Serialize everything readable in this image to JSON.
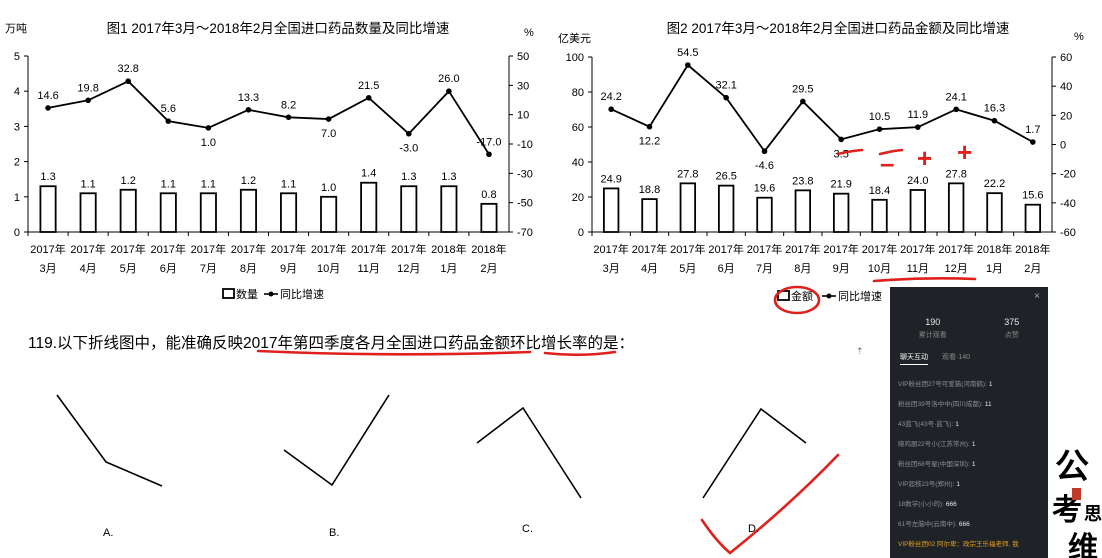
{
  "chart_data": [
    {
      "type": "bar+line",
      "title": "图1  2017年3月～2018年2月全国进口药品数量及同比增速",
      "ylabel_left": "万吨",
      "ylabel_right": "%",
      "yticks_left": [
        "0",
        "1",
        "2",
        "3",
        "4",
        "5"
      ],
      "yticks_right": [
        "-70",
        "-50",
        "-30",
        "-10",
        "10",
        "30",
        "50"
      ],
      "ylim_left": [
        0,
        5
      ],
      "ylim_right": [
        -70,
        50
      ],
      "categories": [
        "3月",
        "4月",
        "5月",
        "6月",
        "7月",
        "8月",
        "9月",
        "10月",
        "11月",
        "12月",
        "1月",
        "2月"
      ],
      "x_year_labels": [
        "2017年",
        "2017年",
        "2017年",
        "2017年",
        "2017年",
        "2017年",
        "2017年",
        "2017年",
        "2017年",
        "2017年",
        "2018年",
        "2018年"
      ],
      "bar_labels": [
        "1.3",
        "1.1",
        "1.2",
        "1.1",
        "1.1",
        "1.2",
        "1.1",
        "1.0",
        "1.4",
        "1.3",
        "1.3",
        "0.8"
      ],
      "line_labels": [
        "14.6",
        "19.8",
        "32.8",
        "5.6",
        "1.0",
        "13.3",
        "8.2",
        "7.0",
        "21.5",
        "-3.0",
        "26.0",
        "-17.0"
      ],
      "series": [
        {
          "name": "数量",
          "kind": "bar",
          "axis": "left",
          "values": [
            1.3,
            1.1,
            1.2,
            1.1,
            1.1,
            1.2,
            1.1,
            1.0,
            1.4,
            1.3,
            1.3,
            0.8
          ]
        },
        {
          "name": "同比增速",
          "kind": "line",
          "axis": "right",
          "values": [
            14.6,
            19.8,
            32.8,
            5.6,
            1.0,
            13.3,
            8.2,
            7.0,
            21.5,
            -3.0,
            26.0,
            -17.0
          ]
        }
      ],
      "legend_placement": "bottom-center",
      "grid": false
    },
    {
      "type": "bar+line",
      "title": "图2  2017年3月～2018年2月全国进口药品金额及同比增速",
      "ylabel_left": "亿美元",
      "ylabel_right": "%",
      "yticks_left": [
        "0",
        "20",
        "40",
        "60",
        "80",
        "100"
      ],
      "yticks_right": [
        "-60",
        "-40",
        "-20",
        "0",
        "20",
        "40",
        "60"
      ],
      "ylim_left": [
        0,
        100
      ],
      "ylim_right": [
        -60,
        60
      ],
      "categories": [
        "3月",
        "4月",
        "5月",
        "6月",
        "7月",
        "8月",
        "9月",
        "10月",
        "11月",
        "12月",
        "1月",
        "2月"
      ],
      "x_year_labels": [
        "2017年",
        "2017年",
        "2017年",
        "2017年",
        "2017年",
        "2017年",
        "2017年",
        "2017年",
        "2017年",
        "2017年",
        "2018年",
        "2018年"
      ],
      "bar_labels": [
        "24.9",
        "18.8",
        "27.8",
        "26.5",
        "19.6",
        "23.8",
        "21.9",
        "18.4",
        "24.0",
        "27.8",
        "22.2",
        "15.6"
      ],
      "line_labels": [
        "24.2",
        "12.2",
        "54.5",
        "32.1",
        "-4.6",
        "29.5",
        "3.5",
        "10.5",
        "11.9",
        "24.1",
        "16.3",
        "1.7"
      ],
      "series": [
        {
          "name": "金额",
          "kind": "bar",
          "axis": "left",
          "values": [
            24.9,
            18.8,
            27.8,
            26.5,
            19.6,
            23.8,
            21.9,
            18.4,
            24.0,
            27.8,
            22.2,
            15.6
          ]
        },
        {
          "name": "同比增速",
          "kind": "line",
          "axis": "right",
          "values": [
            24.2,
            12.2,
            54.5,
            32.1,
            -4.6,
            29.5,
            3.5,
            10.5,
            11.9,
            24.1,
            16.3,
            1.7
          ]
        }
      ],
      "legend_placement": "bottom-center",
      "grid": false
    }
  ],
  "question": {
    "prefix": "119.以下折线图中，能准确反映",
    "highlight1": "2017年第四季度各月全国进口药品金额",
    "highlight2": "环比增长率",
    "suffix": "的是："
  },
  "options": [
    {
      "label": "A."
    },
    {
      "label": "B."
    },
    {
      "label": "C."
    },
    {
      "label": "D."
    }
  ],
  "annotations": {
    "minus": "–",
    "plus1": "+",
    "plus2": "+"
  },
  "chat_panel": {
    "close": "×",
    "stats": [
      {
        "num": "190",
        "label": "累计观看"
      },
      {
        "num": "375",
        "label": "点赞"
      }
    ],
    "tabs": [
      "聊天互动",
      "观看·140"
    ],
    "messages": [
      {
        "text": "VIP粉丝团27号可爱猫(河南鹤):",
        "value": "1"
      },
      {
        "text": "粉丝团39号洛中中(四川成都):",
        "value": "11"
      },
      {
        "text": "43蓝飞(43号·蓝飞):",
        "value": "1"
      },
      {
        "text": "晓鸡丽22号小(江苏常州):",
        "value": "1"
      },
      {
        "text": "粉丝团68号星(中国深圳):",
        "value": "1"
      },
      {
        "text": "VIP超核23号(郑州):",
        "value": "1"
      },
      {
        "text": "18数学(小小的):",
        "value": "666"
      },
      {
        "text": "61号左脑中(云南中):",
        "value": "666"
      },
      {
        "text": "VIP粉丝团02 阿尔卑：政宗王乐福老师, 我",
        "value": ""
      }
    ]
  },
  "logo_text": "公考思维",
  "colors": {
    "bar_fill": "#ffffff",
    "bar_stroke": "#000000",
    "line": "#000000",
    "annotation_red": "#e0201c",
    "chat_bg": "#1f2328"
  }
}
